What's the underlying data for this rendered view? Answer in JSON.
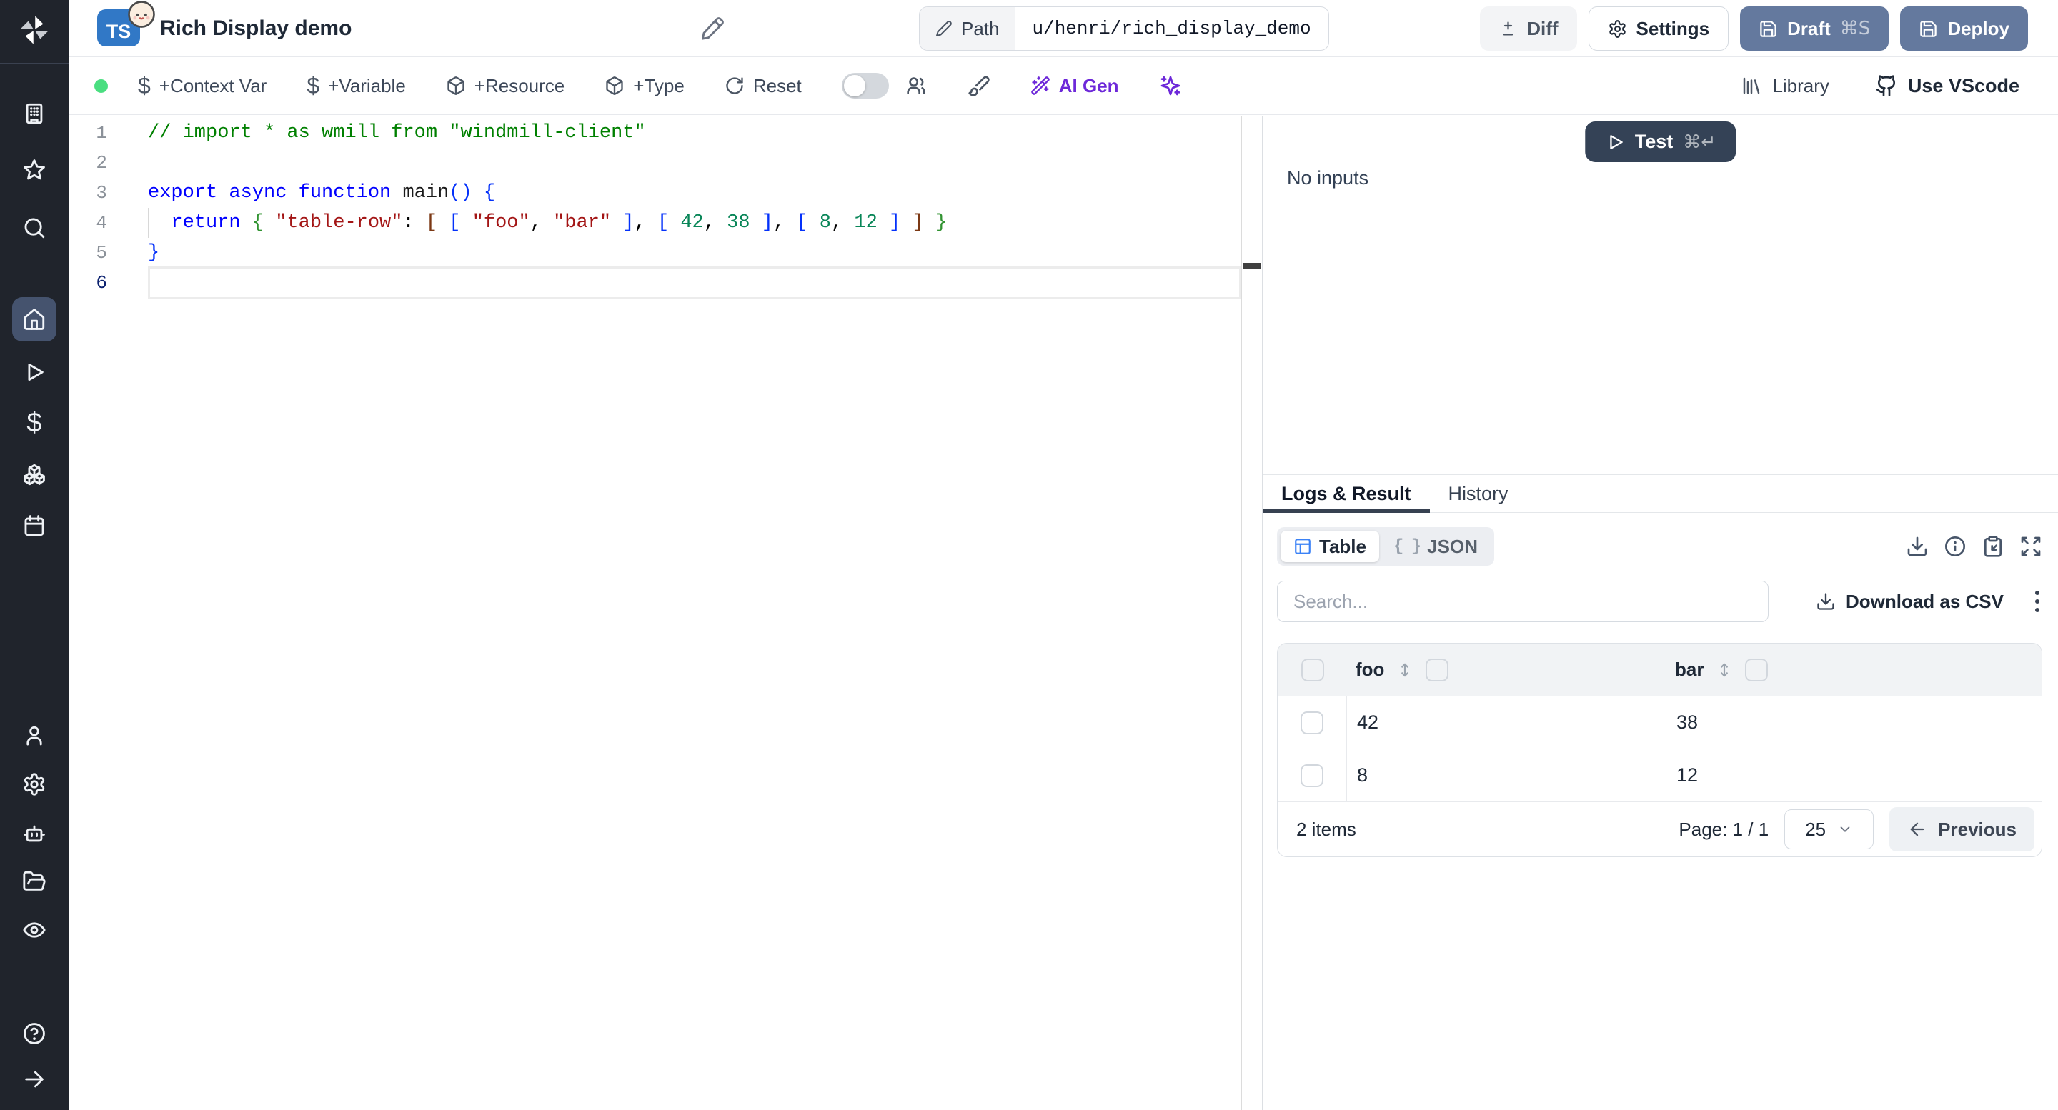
{
  "colors": {
    "sidebar_bg": "#20242c",
    "active_nav_bg": "#45536e",
    "brand_ts_blue": "#3178c6",
    "slate_button": "#64799e",
    "test_button_navy": "#344256",
    "accent_violet": "#6d28d9",
    "status_green": "#4ade80",
    "table_icon_blue": "#3b82f6"
  },
  "sidebar": {
    "icons": [
      "windmill-logo",
      "building",
      "star",
      "search",
      "home",
      "play",
      "dollar",
      "boxes",
      "calendar",
      "user",
      "gear",
      "robot",
      "folder-open",
      "eye",
      "help",
      "arrow-right"
    ],
    "active_item": "home",
    "dollar_glyph": "$"
  },
  "header": {
    "language_badge": "TS",
    "title": "Rich Display demo",
    "path_button": {
      "label": "Path",
      "value": "u/henri/rich_display_demo"
    },
    "diff_label": "Diff",
    "settings_label": "Settings",
    "draft_label": "Draft",
    "draft_shortcut": "⌘S",
    "deploy_label": "Deploy"
  },
  "toolbar": {
    "context_var_label": "+Context Var",
    "variable_label": "+Variable",
    "resource_label": "+Resource",
    "type_label": "+Type",
    "reset_label": "Reset",
    "ai_gen_label": "AI Gen",
    "library_label": "Library",
    "vscode_label": "Use VScode",
    "dollar_glyph": "$"
  },
  "editor": {
    "lines": [
      {
        "num": "1",
        "segments": [
          {
            "t": "// import * as wmill from \"windmill-client\"",
            "c": "comment"
          }
        ]
      },
      {
        "num": "2",
        "segments": []
      },
      {
        "num": "3",
        "segments": [
          {
            "t": "export",
            "c": "kw"
          },
          {
            "t": " ",
            "c": "plain"
          },
          {
            "t": "async",
            "c": "kw"
          },
          {
            "t": " ",
            "c": "plain"
          },
          {
            "t": "function",
            "c": "kw"
          },
          {
            "t": " ",
            "c": "plain"
          },
          {
            "t": "main",
            "c": "fn"
          },
          {
            "t": "() {",
            "c": "b1"
          }
        ]
      },
      {
        "num": "4",
        "indent_guide": true,
        "segments": [
          {
            "t": "  ",
            "c": "plain"
          },
          {
            "t": "return",
            "c": "kw"
          },
          {
            "t": " ",
            "c": "plain"
          },
          {
            "t": "{",
            "c": "b2"
          },
          {
            "t": " ",
            "c": "plain"
          },
          {
            "t": "\"table-row\"",
            "c": "str"
          },
          {
            "t": ": ",
            "c": "plain"
          },
          {
            "t": "[",
            "c": "b3"
          },
          {
            "t": " ",
            "c": "plain"
          },
          {
            "t": "[",
            "c": "b1"
          },
          {
            "t": " ",
            "c": "plain"
          },
          {
            "t": "\"foo\"",
            "c": "str"
          },
          {
            "t": ", ",
            "c": "plain"
          },
          {
            "t": "\"bar\"",
            "c": "str"
          },
          {
            "t": " ",
            "c": "plain"
          },
          {
            "t": "]",
            "c": "b1"
          },
          {
            "t": ", ",
            "c": "plain"
          },
          {
            "t": "[",
            "c": "b1"
          },
          {
            "t": " ",
            "c": "plain"
          },
          {
            "t": "42",
            "c": "num"
          },
          {
            "t": ", ",
            "c": "plain"
          },
          {
            "t": "38",
            "c": "num"
          },
          {
            "t": " ",
            "c": "plain"
          },
          {
            "t": "]",
            "c": "b1"
          },
          {
            "t": ", ",
            "c": "plain"
          },
          {
            "t": "[",
            "c": "b1"
          },
          {
            "t": " ",
            "c": "plain"
          },
          {
            "t": "8",
            "c": "num"
          },
          {
            "t": ", ",
            "c": "plain"
          },
          {
            "t": "12",
            "c": "num"
          },
          {
            "t": " ",
            "c": "plain"
          },
          {
            "t": "]",
            "c": "b1"
          },
          {
            "t": " ",
            "c": "plain"
          },
          {
            "t": "]",
            "c": "b3"
          },
          {
            "t": " ",
            "c": "plain"
          },
          {
            "t": "}",
            "c": "b2"
          }
        ]
      },
      {
        "num": "5",
        "segments": [
          {
            "t": "}",
            "c": "b1"
          }
        ]
      },
      {
        "num": "6",
        "active": true,
        "segments": []
      }
    ]
  },
  "run_panel": {
    "test_label": "Test",
    "test_shortcut": "⌘↵",
    "no_inputs_text": "No inputs"
  },
  "result_panel": {
    "tabs": [
      {
        "label": "Logs & Result",
        "active": true
      },
      {
        "label": "History",
        "active": false
      }
    ],
    "view_modes": [
      {
        "label": "Table",
        "active": true
      },
      {
        "label": "JSON",
        "active": false
      }
    ],
    "json_glyph": "{ }",
    "search_placeholder": "Search...",
    "download_csv_label": "Download as CSV",
    "table": {
      "columns": [
        "foo",
        "bar"
      ],
      "rows": [
        [
          "42",
          "38"
        ],
        [
          "8",
          "12"
        ]
      ],
      "items_text": "2 items",
      "page_text": "Page: 1 / 1",
      "page_size": "25",
      "previous_label": "Previous"
    }
  }
}
